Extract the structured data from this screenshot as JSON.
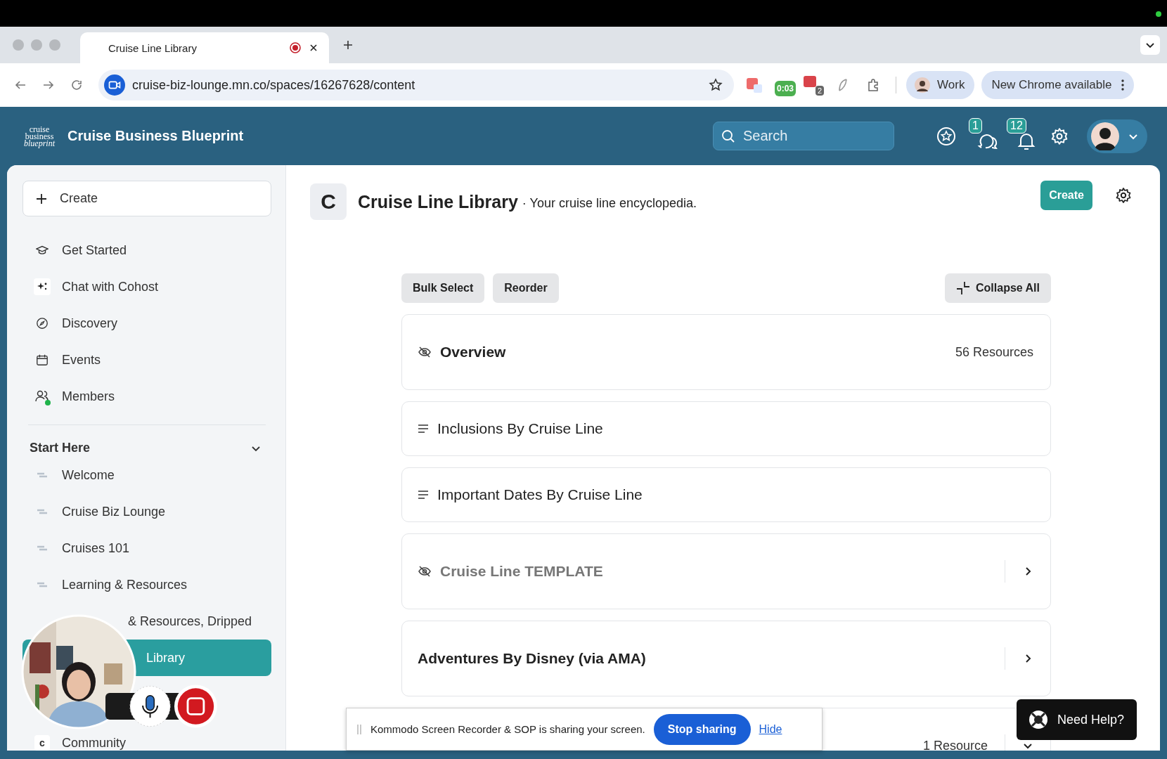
{
  "browser": {
    "tab_title": "Cruise Line Library",
    "url": "cruise-biz-lounge.mn.co/spaces/16267628/content",
    "timer": "0:03",
    "count_badge": "2",
    "profile": "Work",
    "update_button": "New Chrome available"
  },
  "app": {
    "logo_lines": [
      "cruise",
      "business",
      "blueprint"
    ],
    "name": "Cruise Business Blueprint",
    "search_placeholder": "Search",
    "chat_badge": "1",
    "notif_badge": "12"
  },
  "sidebar": {
    "create": "Create",
    "nav": [
      {
        "label": "Get Started",
        "kind": "cap",
        "online": false
      },
      {
        "label": "Chat with Cohost",
        "kind": "sparkle",
        "online": false
      },
      {
        "label": "Discovery",
        "kind": "compass",
        "online": false
      },
      {
        "label": "Events",
        "kind": "calendar",
        "online": false
      },
      {
        "label": "Members",
        "kind": "people",
        "online": true
      }
    ],
    "section": {
      "title": "Start Here",
      "expanded": true,
      "items": [
        {
          "label": "Welcome",
          "kind": "space",
          "selected": false,
          "covered": false
        },
        {
          "label": "Cruise Biz Lounge",
          "kind": "space",
          "selected": false,
          "covered": false
        },
        {
          "label": "Cruises 101",
          "kind": "space",
          "selected": false,
          "covered": false
        },
        {
          "label": "Learning & Resources",
          "kind": "space",
          "selected": false,
          "covered": false
        },
        {
          "label": "& Resources, Dripped",
          "kind": "space",
          "selected": false,
          "covered": true
        },
        {
          "label": "Library",
          "kind": "space",
          "selected": true,
          "covered": true
        },
        {
          "label": "Community",
          "kind": "letter",
          "badge": "c",
          "selected": false,
          "covered": false
        }
      ]
    }
  },
  "page": {
    "icon_letter": "C",
    "title": "Cruise Line Library",
    "subtitle": "· Your cruise line encyclopedia.",
    "create": "Create",
    "actions": [
      "Bulk Select",
      "Reorder"
    ],
    "collapse": "Collapse All",
    "sections": [
      {
        "kind": "group",
        "title": "Overview",
        "hidden": true,
        "dimmed": false,
        "count": "56 Resources"
      },
      {
        "kind": "page",
        "title": "Inclusions By Cruise Line",
        "hidden": false,
        "dimmed": false
      },
      {
        "kind": "page",
        "title": "Important Dates By Cruise Line",
        "hidden": false,
        "dimmed": false
      },
      {
        "kind": "collection",
        "title": "Cruise Line TEMPLATE",
        "hidden": true,
        "dimmed": true,
        "expanded": false
      },
      {
        "kind": "collection",
        "title": "Adventures By Disney (via AMA)",
        "hidden": false,
        "dimmed": false,
        "expanded": false
      },
      {
        "kind": "collection",
        "count": "1 Resource",
        "expanded": true
      }
    ]
  },
  "share_bar": {
    "message": "Kommodo Screen Recorder & SOP is sharing your screen.",
    "stop": "Stop sharing",
    "hide": "Hide"
  },
  "help": "Need Help?"
}
